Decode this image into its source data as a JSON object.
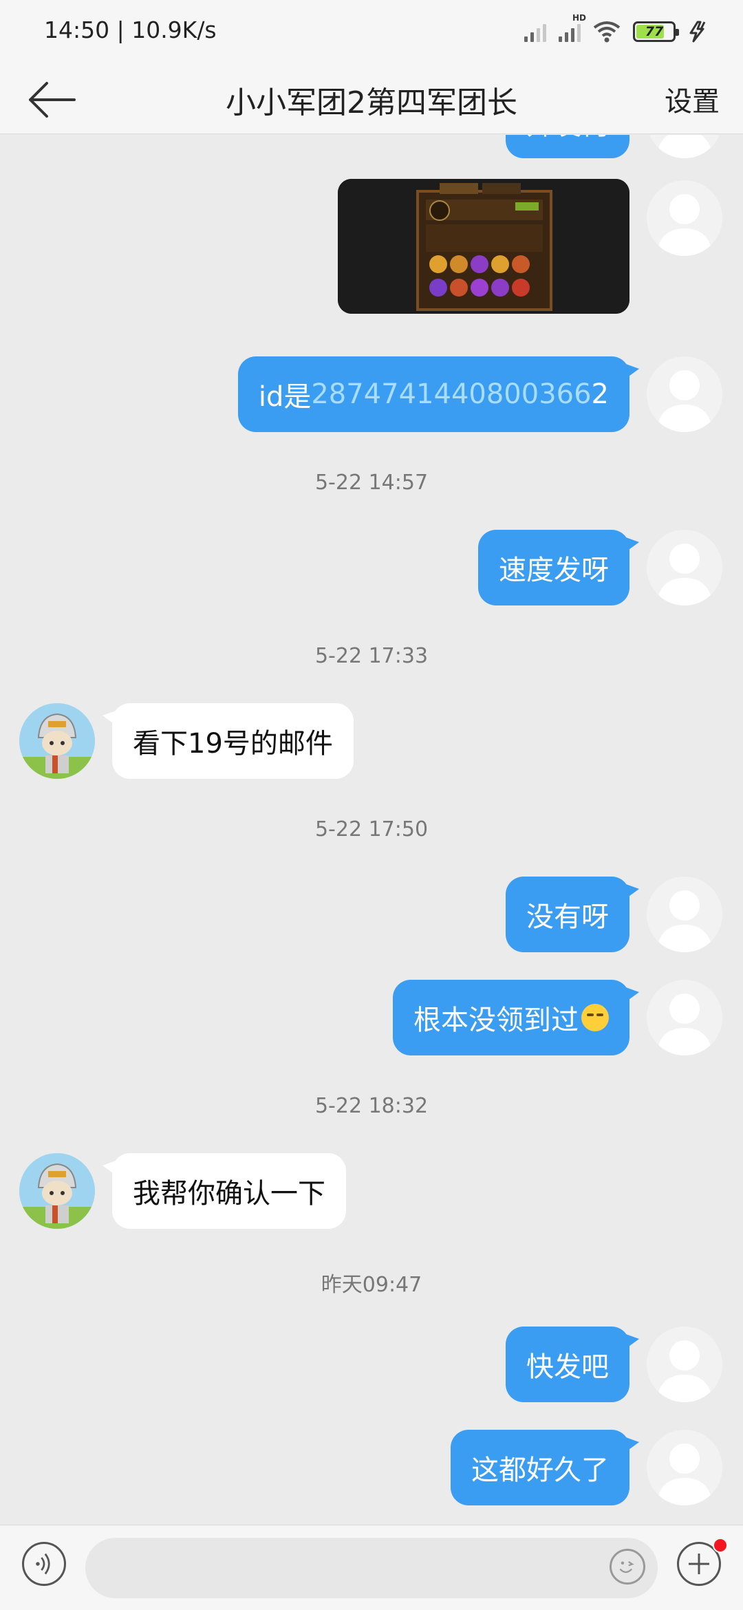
{
  "status_bar": {
    "time": "14:50 | 10.9K/s",
    "network": "HD",
    "battery": "77",
    "icons": [
      "signal-icon",
      "hd-signal-icon",
      "wifi-icon",
      "battery-icon",
      "charging-icon"
    ]
  },
  "header": {
    "title": "小小军团2第四军团长",
    "settings_label": "设置"
  },
  "messages": [
    {
      "id": "m0",
      "side": "right",
      "type": "text",
      "text": "开发何"
    },
    {
      "id": "m1",
      "side": "right",
      "type": "image"
    },
    {
      "id": "m2",
      "side": "right",
      "type": "text",
      "prefix": "id是",
      "link": "2874741440800366",
      "suffix": "2"
    },
    {
      "id": "t1",
      "type": "time",
      "text": "5-22 14:57"
    },
    {
      "id": "m3",
      "side": "right",
      "type": "text",
      "text": "速度发呀"
    },
    {
      "id": "t2",
      "type": "time",
      "text": "5-22 17:33"
    },
    {
      "id": "m4",
      "side": "left",
      "type": "text",
      "text": "看下19号的邮件"
    },
    {
      "id": "t3",
      "type": "time",
      "text": "5-22 17:50"
    },
    {
      "id": "m5",
      "side": "right",
      "type": "text",
      "text": "没有呀"
    },
    {
      "id": "m6",
      "side": "right",
      "type": "text",
      "text": "根本没领到过"
    },
    {
      "id": "t4",
      "type": "time",
      "text": "5-22 18:32"
    },
    {
      "id": "m7",
      "side": "left",
      "type": "text",
      "text": "我帮你确认一下"
    },
    {
      "id": "t5",
      "type": "time",
      "text": "昨天09:47"
    },
    {
      "id": "m8",
      "side": "right",
      "type": "text",
      "text": "快发吧"
    },
    {
      "id": "m9",
      "side": "right",
      "type": "text",
      "text": "这都好久了"
    }
  ],
  "input_bar": {
    "placeholder": "",
    "icons": [
      "voice-icon",
      "emoji-icon",
      "plus-icon"
    ]
  },
  "colors": {
    "outgoing_bubble": "#3b9df2",
    "incoming_bubble": "#ffffff",
    "background": "#ebebeb",
    "link_text": "#a9ddff",
    "notification_dot": "#f4161e"
  }
}
